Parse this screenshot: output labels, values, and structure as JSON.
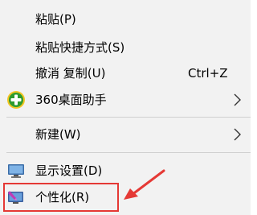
{
  "menu": {
    "paste": {
      "label": "粘贴(P)"
    },
    "paste_shortcut": {
      "label": "粘贴快捷方式(S)"
    },
    "undo_copy": {
      "label": "撤消 复制(U)",
      "shortcut": "Ctrl+Z"
    },
    "desktop_helper": {
      "label": "360桌面助手",
      "icon": "360-plus-icon"
    },
    "new": {
      "label": "新建(W)"
    },
    "display_settings": {
      "label": "显示设置(D)",
      "icon": "monitor-icon"
    },
    "personalize": {
      "label": "个性化(R)",
      "icon": "personalize-icon"
    }
  },
  "annotation": {
    "color": "#e53935"
  },
  "colors": {
    "menu_bg": "#f2f2f2",
    "separator": "#d0d0d0",
    "accent_360_green": "#2e9b2e",
    "accent_360_yellow": "#f3c623"
  }
}
